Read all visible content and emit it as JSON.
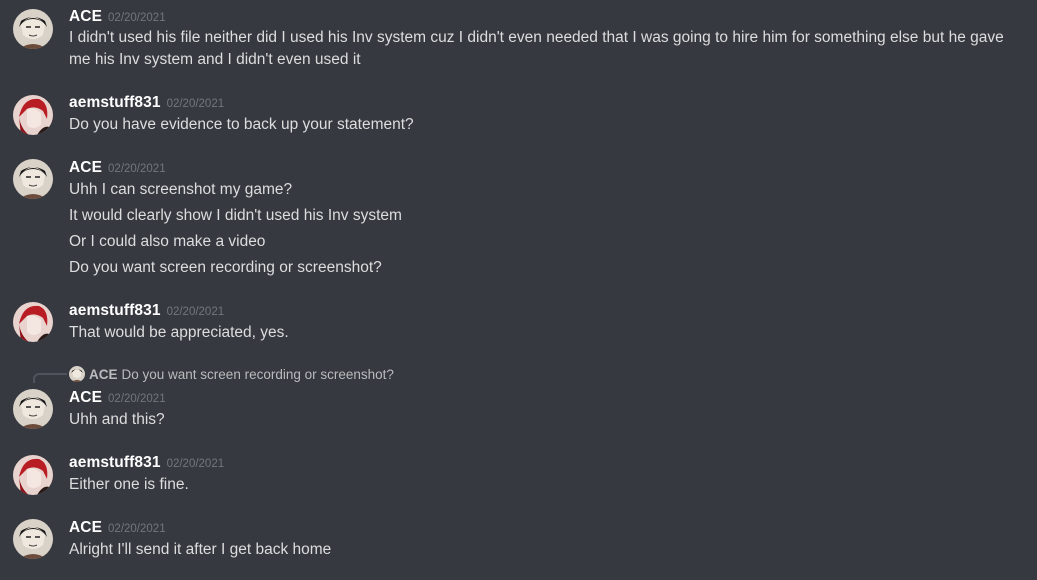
{
  "messages": [
    {
      "author": "ACE",
      "timestamp": "02/20/2021",
      "avatar": "ace-avatar",
      "lines": [
        "I didn't used his file neither did I used his Inv system cuz I didn't even needed that I was going to hire him for something else but he gave",
        "me his Inv system and I didn't even used it"
      ]
    },
    {
      "author": "aemstuff831",
      "timestamp": "02/20/2021",
      "avatar": "aem-avatar",
      "lines": [
        "Do you have evidence to back up your statement?"
      ]
    },
    {
      "author": "ACE",
      "timestamp": "02/20/2021",
      "avatar": "ace-avatar",
      "lines": [
        "Uhh I can screenshot my game?",
        "It would clearly show I didn't used his Inv system",
        "Or I could also make a video",
        "Do you want screen recording or screenshot?"
      ]
    },
    {
      "author": "aemstuff831",
      "timestamp": "02/20/2021",
      "avatar": "aem-avatar",
      "lines": [
        "That would be appreciated, yes."
      ]
    },
    {
      "author": "ACE",
      "timestamp": "02/20/2021",
      "avatar": "ace-avatar",
      "reply": {
        "author": "ACE",
        "text": "Do you want screen recording or screenshot?"
      },
      "lines": [
        "Uhh and this?"
      ]
    },
    {
      "author": "aemstuff831",
      "timestamp": "02/20/2021",
      "avatar": "aem-avatar",
      "lines": [
        "Either one is fine."
      ]
    },
    {
      "author": "ACE",
      "timestamp": "02/20/2021",
      "avatar": "ace-avatar",
      "lines": [
        "Alright I'll send it after I get back home"
      ]
    }
  ]
}
